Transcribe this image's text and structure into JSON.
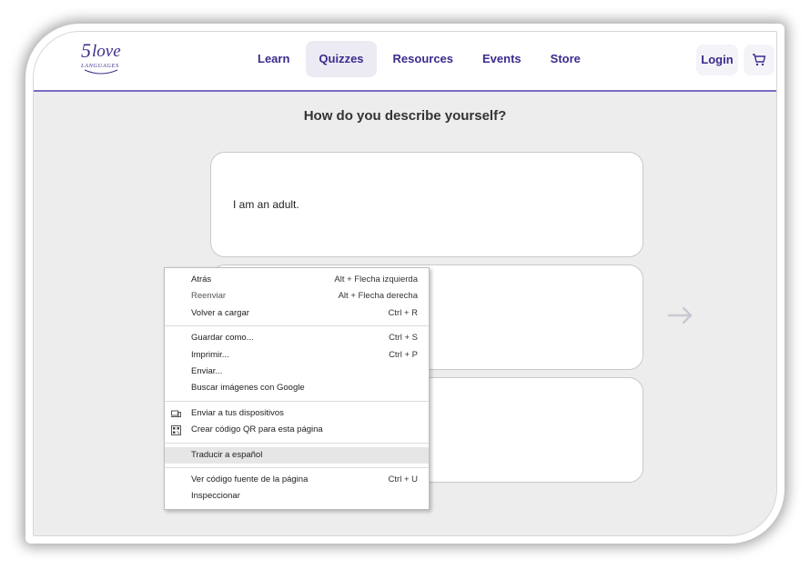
{
  "logo": {
    "number": "5",
    "word": "love",
    "sub": "LANGUAGES"
  },
  "nav": {
    "items": [
      "Learn",
      "Quizzes",
      "Resources",
      "Events",
      "Store"
    ],
    "active_index": 1,
    "login": "Login"
  },
  "quiz": {
    "question": "How do you describe yourself?",
    "answers": [
      "I am an adult."
    ]
  },
  "context_menu": {
    "groups": [
      [
        {
          "label": "Atrás",
          "shortcut": "Alt + Flecha izquierda"
        },
        {
          "label": "Reenviar",
          "shortcut": "Alt + Flecha derecha"
        },
        {
          "label": "Volver a cargar",
          "shortcut": "Ctrl + R"
        }
      ],
      [
        {
          "label": "Guardar como...",
          "shortcut": "Ctrl + S"
        },
        {
          "label": "Imprimir...",
          "shortcut": "Ctrl + P"
        },
        {
          "label": "Enviar..."
        },
        {
          "label": "Buscar imágenes con Google"
        }
      ],
      [
        {
          "label": "Enviar a tus dispositivos",
          "icon": "devices-icon"
        },
        {
          "label": "Crear código QR para esta página",
          "icon": "qr-code-icon"
        }
      ],
      [
        {
          "label": "Traducir a español"
        }
      ],
      [
        {
          "label": "Ver código fuente de la página",
          "shortcut": "Ctrl + U"
        },
        {
          "label": "Inspeccionar"
        }
      ]
    ]
  },
  "colors": {
    "brand": "#3b2b8c",
    "accent_line": "#7a6bc4"
  }
}
